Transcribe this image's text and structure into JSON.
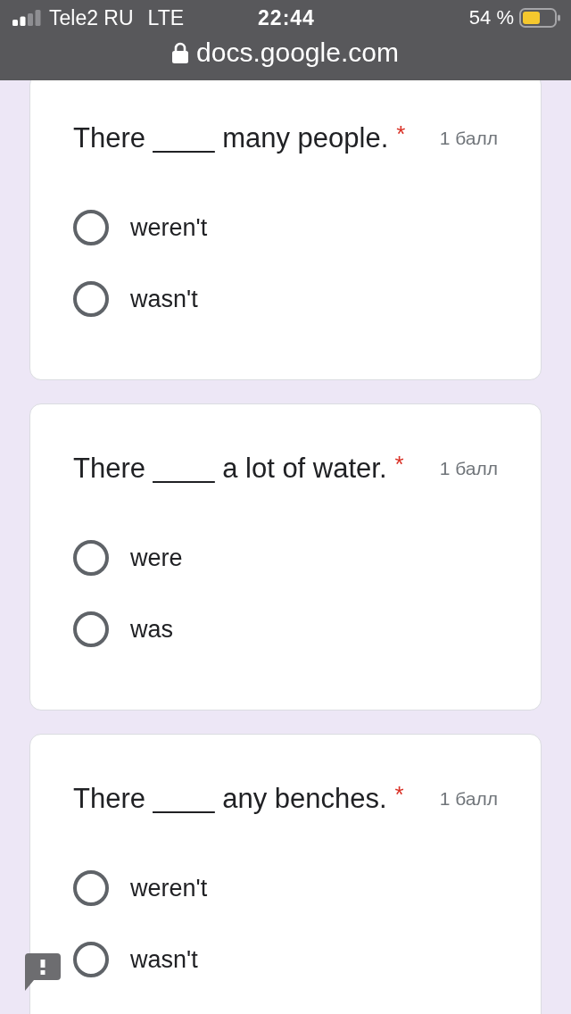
{
  "status_bar": {
    "carrier": "Tele2 RU",
    "network": "LTE",
    "time": "22:44",
    "battery": "54 %"
  },
  "address_bar": {
    "url": "docs.google.com"
  },
  "questions": [
    {
      "title": "There ____ many people.",
      "required_mark": "*",
      "points": "1 балл",
      "options": [
        {
          "label": "weren't",
          "selected": false
        },
        {
          "label": "wasn't",
          "selected": false
        }
      ]
    },
    {
      "title": "There ____ a lot of water.",
      "required_mark": "*",
      "points": "1 балл",
      "options": [
        {
          "label": "were",
          "selected": false
        },
        {
          "label": "was",
          "selected": false
        }
      ]
    },
    {
      "title": "There ____ any benches.",
      "required_mark": "*",
      "points": "1 балл",
      "options": [
        {
          "label": "weren't",
          "selected": false
        },
        {
          "label": "wasn't",
          "selected": false
        }
      ]
    }
  ]
}
